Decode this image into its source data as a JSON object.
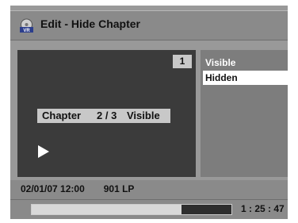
{
  "header": {
    "title": "Edit - Hide Chapter",
    "icon": "vr-disc-icon",
    "icon_label": "VR"
  },
  "preview": {
    "chapter_number": "1",
    "chapter_label": "Chapter",
    "chapter_position": "2 / 3",
    "chapter_state": "Visible",
    "playback_icon": "play-icon"
  },
  "options": {
    "items": [
      {
        "label": "Visible",
        "selected": false
      },
      {
        "label": "Hidden",
        "selected": true
      }
    ]
  },
  "status": {
    "datetime": "02/01/07 12:00",
    "channel_mode": "901 LP"
  },
  "progress": {
    "fraction": 0.75,
    "elapsed": "1 : 25 : 47"
  },
  "colors": {
    "frame": "#999999",
    "preview_bg": "#3b3b3b",
    "highlight": "#ffffff"
  }
}
